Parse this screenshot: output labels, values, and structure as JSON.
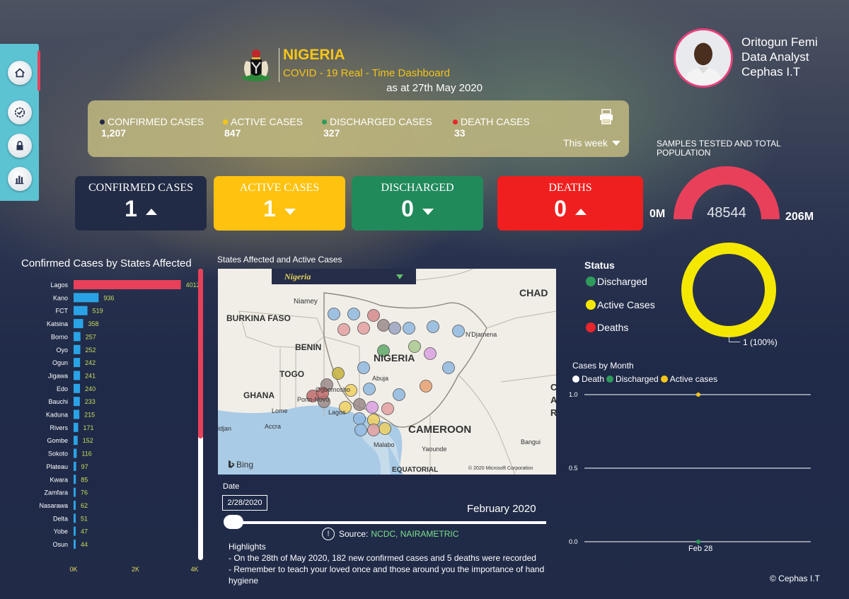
{
  "header": {
    "country": "NIGERIA",
    "subtitle": "COVID - 19 Real - Time Dashboard",
    "as_at": "as at 27th May 2020"
  },
  "author": {
    "name": "Oritogun Femi",
    "role": "Data Analyst",
    "company": "Cephas I.T"
  },
  "nav": {
    "items": [
      {
        "icon": "home-icon"
      },
      {
        "icon": "check-badge-icon"
      },
      {
        "icon": "lock-icon"
      },
      {
        "icon": "bar-chart-icon"
      }
    ]
  },
  "summary": {
    "items": [
      {
        "label": "CONFIRMED CASES",
        "value": "1,207",
        "color": "#1f2742"
      },
      {
        "label": "ACTIVE CASES",
        "value": "847",
        "color": "#f5c518"
      },
      {
        "label": "DISCHARGED CASES",
        "value": "327",
        "color": "#2e9a5c"
      },
      {
        "label": "DEATH CASES",
        "value": "33",
        "color": "#e8262b"
      }
    ],
    "period": "This week"
  },
  "kpis": [
    {
      "label": "CONFIRMED CASES",
      "value": "1",
      "trend": "up",
      "bg": "#222b45",
      "fg": "#ffffff"
    },
    {
      "label": "ACTIVE CASES",
      "value": "1",
      "trend": "down",
      "bg": "#ffc20e",
      "fg": "#ffffff"
    },
    {
      "label": "DISCHARGED",
      "value": "0",
      "trend": "down",
      "bg": "#218a5b",
      "fg": "#ffffff"
    },
    {
      "label": "DEATHS",
      "value": "0",
      "trend": "up",
      "bg": "#f01f1f",
      "fg": "#ffffff"
    }
  ],
  "gauge": {
    "title": "SAMPLES TESTED and TOTAL POPULATION",
    "min": "0M",
    "max": "206M",
    "value": "48544",
    "fill_color": "#e8405a"
  },
  "states_chart": {
    "title": "Confirmed Cases by States Affected",
    "axis": [
      "0K",
      "2K",
      "4K"
    ]
  },
  "chart_data": {
    "type": "bar",
    "orientation": "horizontal",
    "title": "Confirmed Cases by States Affected",
    "categories": [
      "Lagos",
      "Kano",
      "FCT",
      "Katsina",
      "Borno",
      "Oyo",
      "Ogun",
      "Jigawa",
      "Edo",
      "Bauchi",
      "Kaduna",
      "Rivers",
      "Gombe",
      "Sokoto",
      "Plateau",
      "Kwara",
      "Zamfara",
      "Nasarawa",
      "Delta",
      "Yobe",
      "Osun"
    ],
    "values": [
      4012,
      936,
      519,
      358,
      257,
      252,
      242,
      241,
      240,
      233,
      215,
      171,
      152,
      116,
      97,
      85,
      76,
      62,
      51,
      47,
      44
    ],
    "xlim": [
      0,
      4000
    ],
    "x_ticks": [
      "0K",
      "2K",
      "4K"
    ],
    "highlight_color": "#e8405a",
    "bar_color": "#2aa3e6"
  },
  "map": {
    "title": "States Affected and Active Cases",
    "selector": "Nigeria",
    "labels": {
      "chad": "CHAD",
      "burkina": "BURKINA FASO",
      "niamey": "Niamey",
      "benin": "BENIN",
      "togo": "TOGO",
      "nigeria": "NIGERIA",
      "ghana": "GHANA",
      "cameroon": "CAMEROON",
      "ndjamena": "N'Djamena",
      "abuja": "Abuja",
      "ogbomosho": "Ogbomosho",
      "lagos": "Lagos",
      "lome": "Lome",
      "accra": "Accra",
      "malabo": "Malabo",
      "yaounde": "Yaounde",
      "bangui": "Bangui",
      "equatorial": "EQUATORIAL",
      "porto": "Porto-Novo",
      "abidjan": "idjan",
      "car": "C",
      "car2": "A",
      "car3": "R"
    },
    "attribution": "© 2020 Microsoft Corporation",
    "brand": "Bing"
  },
  "date_slicer": {
    "label": "Date",
    "value": "2/28/2020",
    "month": "February 2020"
  },
  "source": {
    "prefix": "Source:",
    "value": "NCDC, NAIRAMETRIC"
  },
  "highlights": {
    "title": "Highlights",
    "line1": "-  On the 28th of May 2020, 182 new confirmed cases and 5 deaths were recorded",
    "line2": "-  Remember to teach your loved once and those around you the importance of hand hygiene"
  },
  "status": {
    "title": "Status",
    "items": [
      {
        "label": "Discharged",
        "color": "#2e9a5c"
      },
      {
        "label": "Active Cases",
        "color": "#f5e800"
      },
      {
        "label": "Deaths",
        "color": "#e8262b"
      }
    ],
    "donut_label": "1 (100%)",
    "donut_color": "#f5e800"
  },
  "month_chart": {
    "title": "Cases by Month",
    "legend": [
      {
        "label": "Death",
        "color": "#ffffff"
      },
      {
        "label": "Discharged",
        "color": "#2e9a5c"
      },
      {
        "label": "Active cases",
        "color": "#f5c518"
      }
    ],
    "y_ticks": [
      "1.0",
      "0.5",
      "0.0"
    ],
    "x_label": "Feb 28"
  },
  "copyright": "© Cephas I.T"
}
